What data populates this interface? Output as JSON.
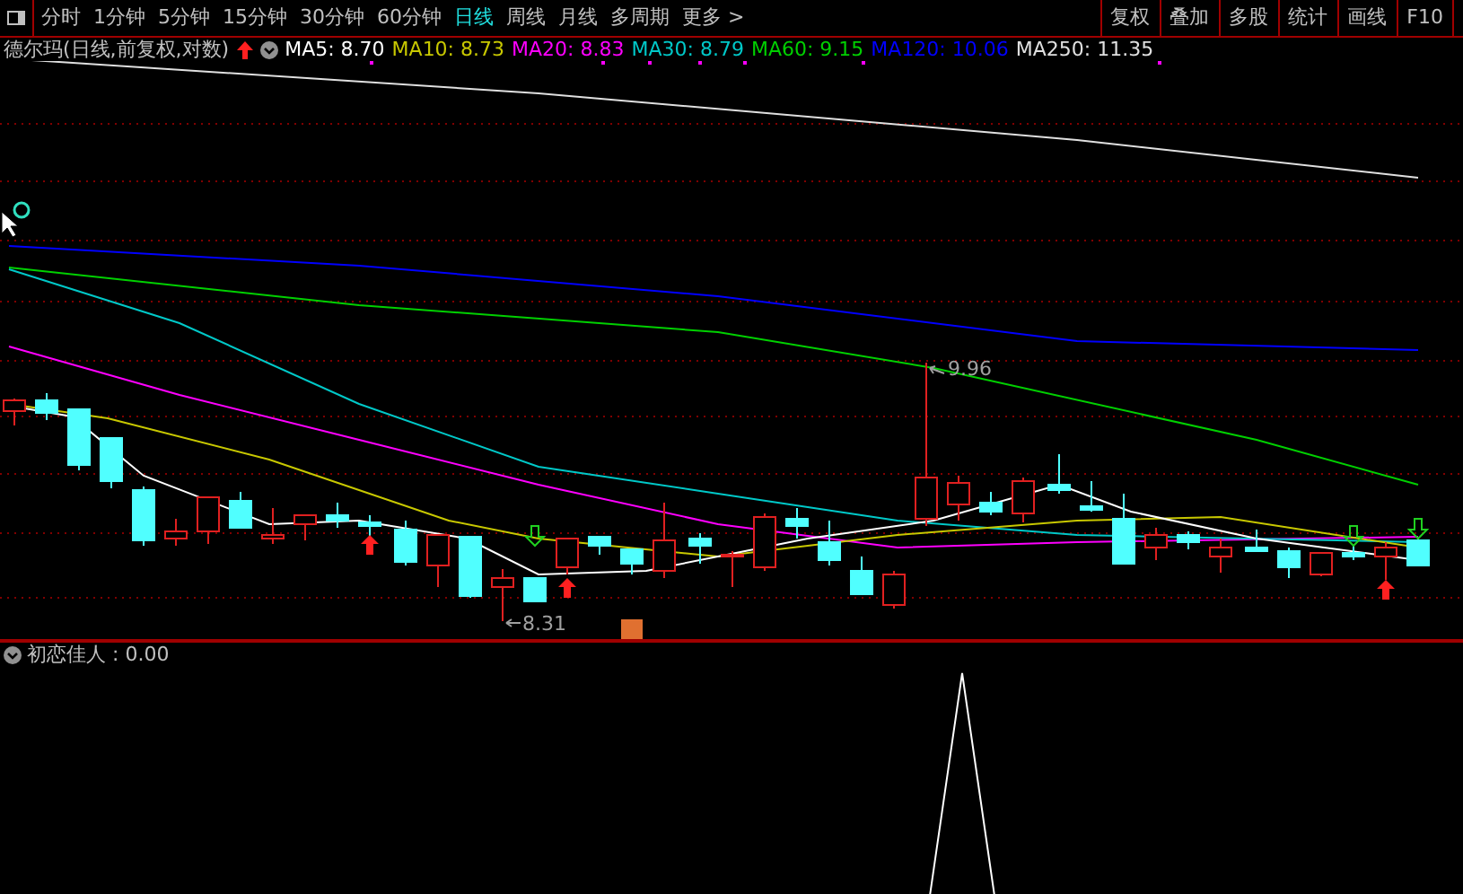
{
  "toolbar": {
    "periods": [
      {
        "label": "分时",
        "selected": false
      },
      {
        "label": "1分钟",
        "selected": false
      },
      {
        "label": "5分钟",
        "selected": false
      },
      {
        "label": "15分钟",
        "selected": false
      },
      {
        "label": "30分钟",
        "selected": false
      },
      {
        "label": "60分钟",
        "selected": false
      },
      {
        "label": "日线",
        "selected": true
      },
      {
        "label": "周线",
        "selected": false
      },
      {
        "label": "月线",
        "selected": false
      },
      {
        "label": "多周期",
        "selected": false
      },
      {
        "label": "更多 >",
        "selected": false
      }
    ],
    "tools": [
      "复权",
      "叠加",
      "多股",
      "统计",
      "画线",
      "F10"
    ]
  },
  "legend": {
    "title": "德尔玛(日线,前复权,对数)",
    "items": [
      {
        "label": "MA5: 8.70",
        "color": "#ffffff"
      },
      {
        "label": "MA10: 8.73",
        "color": "#c8c800"
      },
      {
        "label": "MA20: 8.83",
        "color": "#ff00ff"
      },
      {
        "label": "MA30: 8.79",
        "color": "#00c8c8"
      },
      {
        "label": "MA60: 9.15",
        "color": "#00d000"
      },
      {
        "label": "MA120: 10.06",
        "color": "#0000ff"
      },
      {
        "label": "MA250: 11.35",
        "color": "#e0e0e0"
      }
    ]
  },
  "price_chart": {
    "high_label": "9.96",
    "low_label": "8.31"
  },
  "indicator": {
    "label": "初恋佳人 : 0.00"
  }
}
